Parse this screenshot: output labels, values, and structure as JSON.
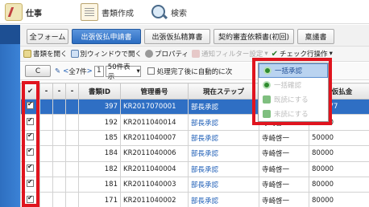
{
  "nav": {
    "items": [
      {
        "label": "仕事",
        "icon": "work-icon"
      },
      {
        "label": "書類作成",
        "icon": "document-create-icon"
      },
      {
        "label": "検索",
        "icon": "search-icon"
      }
    ]
  },
  "tabs": [
    {
      "label": "全フォーム"
    },
    {
      "label": "出張仮払申請書"
    },
    {
      "label": "出張仮払精算書"
    },
    {
      "label": "契約審査依頼書(初回)"
    },
    {
      "label": "稟議書"
    }
  ],
  "toolbar": {
    "open_document": "書類を開く",
    "open_new_window": "別ウィンドウで開く",
    "properties": "プロパティ",
    "notification_filter": "通知フィルター設定",
    "check_operations": "チェック行操作"
  },
  "pager": {
    "refresh_label": "C",
    "prev": "<",
    "total": "全7件",
    "next": ">",
    "page": "1",
    "per_page": "50件表示",
    "auto_next_label": "処理完了後に自動的に次"
  },
  "dropdown": {
    "items": [
      {
        "label": "一括承認",
        "state": "active",
        "color": "#2e8b2e"
      },
      {
        "label": "一括確認",
        "state": "disabled",
        "color": "#2e8b2e"
      },
      {
        "label": "既読にする",
        "state": "disabled",
        "color": "#2e8b2e"
      },
      {
        "label": "未読にする",
        "state": "disabled",
        "color": "#2e8b2e"
      }
    ]
  },
  "table": {
    "columns": [
      "✔",
      "-",
      "-",
      "-",
      "書類ID",
      "管理番号",
      "現在ステップ",
      "",
      "仮払金"
    ],
    "rows": [
      {
        "id": "397",
        "mgmt": "KR2017070001",
        "step": "部長承認",
        "person": "",
        "amount": "777777",
        "selected": true
      },
      {
        "id": "192",
        "mgmt": "KR2011040014",
        "step": "部長承認",
        "person": "寺崎啓一",
        "amount": "80000",
        "selected": false
      },
      {
        "id": "185",
        "mgmt": "KR2011040007",
        "step": "部長承認",
        "person": "寺崎啓一",
        "amount": "50000",
        "selected": false
      },
      {
        "id": "184",
        "mgmt": "KR2011040006",
        "step": "部長承認",
        "person": "寺崎啓一",
        "amount": "80000",
        "selected": false
      },
      {
        "id": "182",
        "mgmt": "KR2011040004",
        "step": "部長承認",
        "person": "寺崎啓一",
        "amount": "80000",
        "selected": false
      },
      {
        "id": "181",
        "mgmt": "KR2011040003",
        "step": "部長承認",
        "person": "寺崎啓一",
        "amount": "80000",
        "selected": false
      },
      {
        "id": "171",
        "mgmt": "KR2011040002",
        "step": "部長承認",
        "person": "寺崎啓一",
        "amount": "80000",
        "selected": false
      }
    ]
  },
  "colors": {
    "accent": "#2f6fc4",
    "highlight_red": "#e0141e"
  }
}
